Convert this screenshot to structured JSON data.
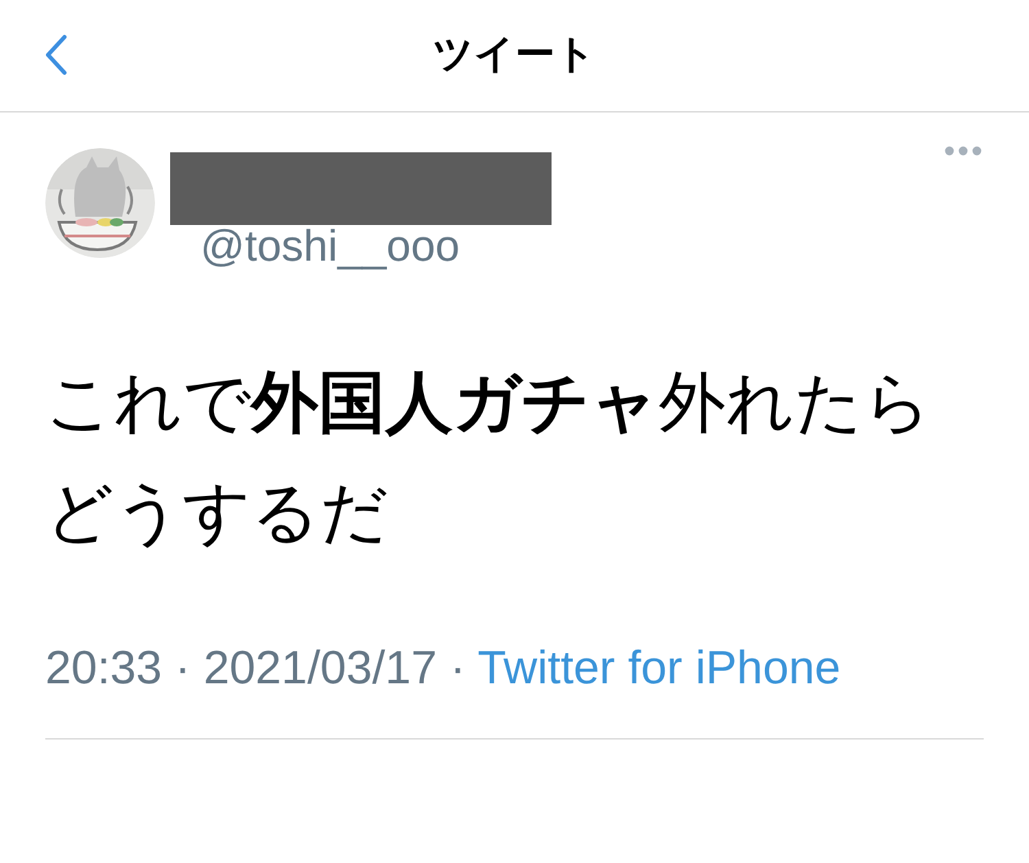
{
  "header": {
    "title": "ツイート"
  },
  "tweet": {
    "handle": "@toshi__ooo",
    "name_redacted": true,
    "text": "これで**外国人ガチャ**外れたらどうするだ",
    "time": "20:33",
    "separator_1": "·",
    "date": "2021/03/17",
    "separator_2": "·",
    "source": "Twitter for iPhone"
  }
}
